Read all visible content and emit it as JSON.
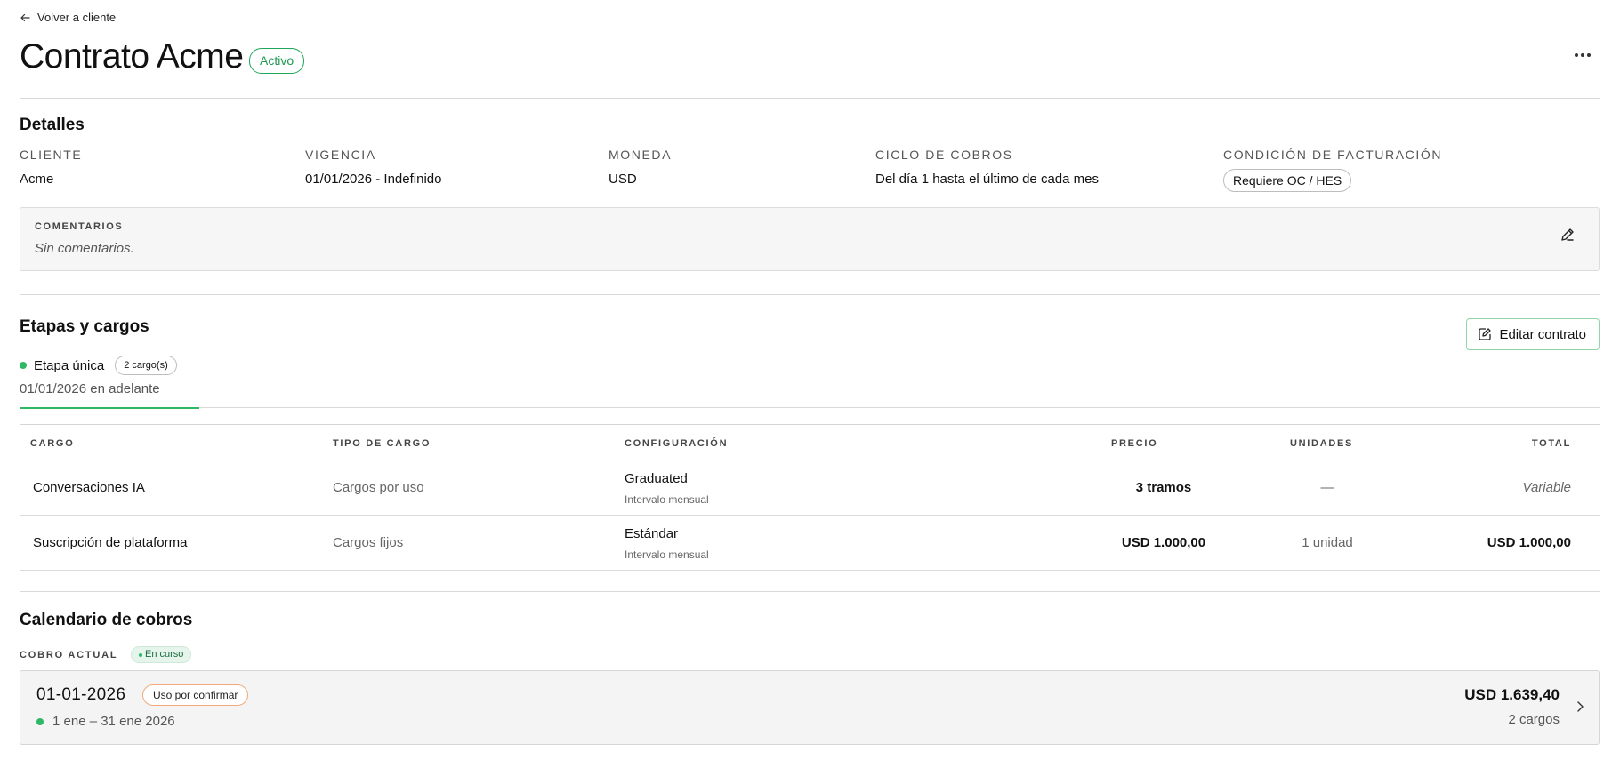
{
  "nav": {
    "back_label": "Volver a cliente"
  },
  "header": {
    "title": "Contrato Acme",
    "status": "Activo"
  },
  "details": {
    "section_title": "Detalles",
    "fields": [
      {
        "label": "Cliente",
        "value": "Acme"
      },
      {
        "label": "Vigencia",
        "value": "01/01/2026 - Indefinido"
      },
      {
        "label": "Moneda",
        "value": "USD"
      },
      {
        "label": "Ciclo de cobros",
        "value": "Del día 1 hasta el último de cada mes"
      },
      {
        "label": "Condición de facturación",
        "value": "Requiere OC / HES"
      }
    ],
    "comments": {
      "label": "COMENTARIOS",
      "text": "Sin comentarios."
    }
  },
  "stages": {
    "section_title": "Etapas y cargos",
    "edit_button": "Editar contrato",
    "stage": {
      "name": "Etapa única",
      "count": "2 cargo(s)",
      "date": "01/01/2026 en adelante"
    },
    "table": {
      "headers": [
        "CARGO",
        "TIPO DE CARGO",
        "CONFIGURACIÓN",
        "PRECIO",
        "UNIDADES",
        "TOTAL"
      ],
      "rows": [
        {
          "cargo": "Conversaciones IA",
          "tipo": "Cargos por uso",
          "config": "Graduated",
          "interval": "Intervalo mensual",
          "precio": "3 tramos",
          "unidades": "—",
          "total": "Variable"
        },
        {
          "cargo": "Suscripción de plataforma",
          "tipo": "Cargos fijos",
          "config": "Estándar",
          "interval": "Intervalo mensual",
          "precio": "USD 1.000,00",
          "unidades": "1 unidad",
          "total": "USD 1.000,00"
        }
      ]
    }
  },
  "calendar": {
    "section_title": "Calendario de cobros",
    "current_label": "COBRO ACTUAL",
    "current_status": "En curso",
    "card": {
      "date": "01-01-2026",
      "status": "Uso por confirmar",
      "range": "1 ene – 31 ene 2026",
      "amount": "USD 1.639,40",
      "count": "2 cargos"
    }
  },
  "colors": {
    "accent": "#2eb866",
    "status_active": "#1d9a50",
    "warning_border": "#f0a97a"
  }
}
